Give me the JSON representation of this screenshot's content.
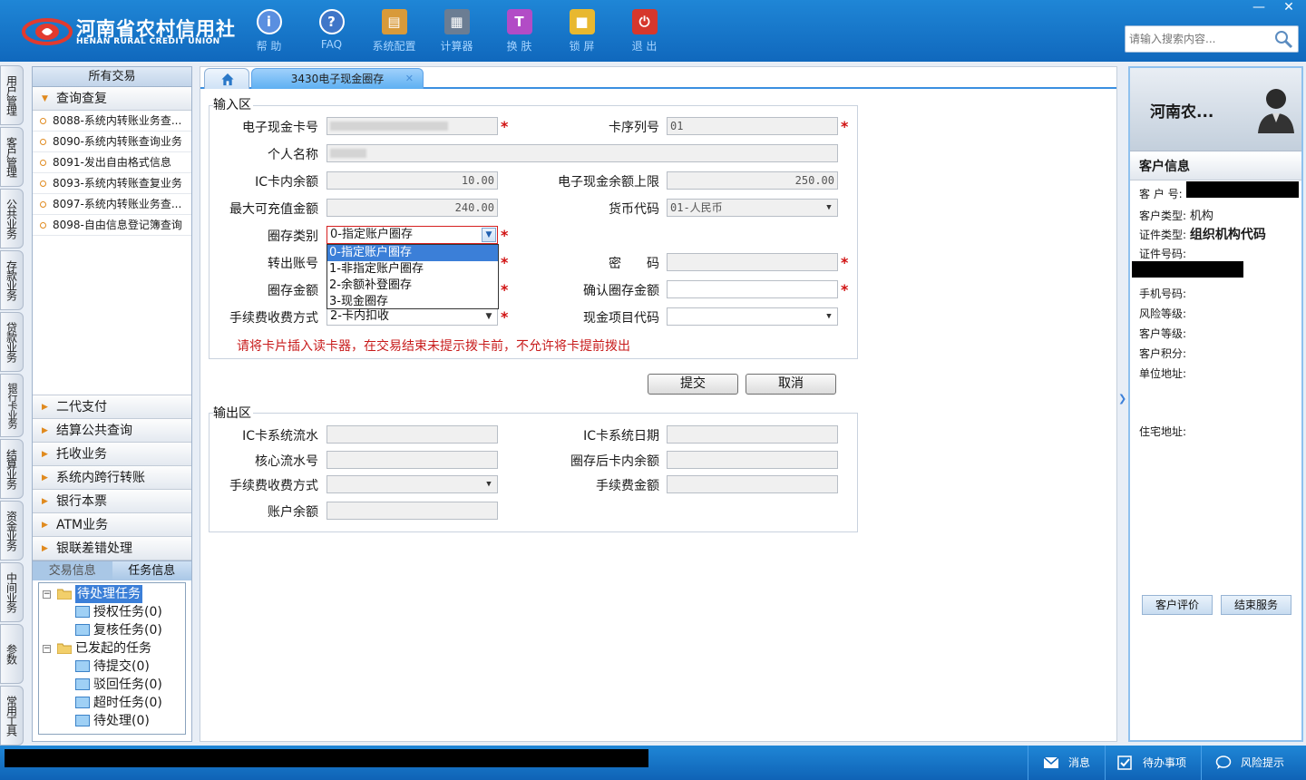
{
  "app": {
    "logo_name": "河南省农村信用社",
    "logo_sub": "HENAN RURAL CREDIT UNION",
    "search_placeholder": "请输入搜索内容..."
  },
  "toolbar": [
    {
      "label": "帮 助",
      "icon": "info-icon",
      "color": "#5a8fe0"
    },
    {
      "label": "FAQ",
      "icon": "question-icon",
      "color": "#3f76c8"
    },
    {
      "label": "系统配置",
      "icon": "toolbox-icon",
      "color": "#d89a3a"
    },
    {
      "label": "计算器",
      "icon": "calculator-icon",
      "color": "#6b7d93"
    },
    {
      "label": "换 肤",
      "icon": "shirt-icon",
      "color": "#b24cc6"
    },
    {
      "label": "锁 屏",
      "icon": "lock-icon",
      "color": "#e8b830"
    },
    {
      "label": "退 出",
      "icon": "power-icon",
      "color": "#d6372c"
    }
  ],
  "vtabs": [
    "用户管理",
    "客户管理",
    "公共业务",
    "存款业务",
    "贷款业务",
    "银行卡业务",
    "结算业务",
    "资金业务",
    "中间业务",
    "参数",
    "常用工具"
  ],
  "leftnav": {
    "top": "所有交易",
    "open_group": "查询查复",
    "items": [
      "8088-系统内转账业务查...",
      "8090-系统内转账查询业务",
      "8091-发出自由格式信息",
      "8093-系统内转账查复业务",
      "8097-系统内转账业务查...",
      "8098-自由信息登记簿查询"
    ],
    "groups": [
      "二代支付",
      "结算公共查询",
      "托收业务",
      "系统内跨行转账",
      "银行本票",
      "ATM业务",
      "银联差错处理"
    ],
    "task_tabs": [
      "交易信息",
      "任务信息"
    ],
    "tree": {
      "pending": "待处理任务",
      "pending_children": [
        "授权任务(0)",
        "复核任务(0)"
      ],
      "initiated": "已发起的任务",
      "initiated_children": [
        "待提交(0)",
        "驳回任务(0)",
        "超时任务(0)",
        "待处理(0)"
      ]
    }
  },
  "tabs": {
    "page_tab": "3430电子现金圈存"
  },
  "input_section": {
    "legend": "输入区",
    "labels": {
      "card_no": "电子现金卡号",
      "card_seq": "卡序列号",
      "name": "个人名称",
      "ic_balance": "IC卡内余额",
      "ecash_limit": "电子现金余额上限",
      "max_recharge": "最大可充值金额",
      "currency": "货币代码",
      "load_type": "圈存类别",
      "out_account": "转出账号",
      "password": "密　　码",
      "load_amount": "圈存金额",
      "confirm_amount": "确认圈存金额",
      "fee_method": "手续费收费方式",
      "cash_item_code": "现金项目代码"
    },
    "values": {
      "card_seq": "01",
      "ic_balance": "10.00",
      "ecash_limit": "250.00",
      "max_recharge": "240.00",
      "currency": "01-人民币",
      "load_type": "0-指定账户圈存",
      "fee_method": "2-卡内扣收"
    },
    "load_type_options": [
      "0-指定账户圈存",
      "1-非指定账户圈存",
      "2-余额补登圈存",
      "3-现金圈存"
    ],
    "notice": "请将卡片插入读卡器，在交易结束未提示拨卡前，不允许将卡提前拨出",
    "submit": "提交",
    "cancel": "取消"
  },
  "output_section": {
    "legend": "输出区",
    "labels": {
      "ic_serial": "IC卡系统流水",
      "ic_date": "IC卡系统日期",
      "core_serial": "核心流水号",
      "post_balance": "圈存后卡内余额",
      "fee_method": "手续费收费方式",
      "fee_amount": "手续费金额",
      "account_balance": "账户余额"
    }
  },
  "customer": {
    "header_title": "河南农...",
    "section_title": "客户信息",
    "customer_no_label": "客 户 号:",
    "customer_type_label": "客户类型:",
    "customer_type": "机构",
    "id_type_label": "证件类型:",
    "id_type": "组织机构代码",
    "id_no_label": "证件号码:",
    "mobile_label": "手机号码:",
    "risk_label": "风险等级:",
    "level_label": "客户等级:",
    "points_label": "客户积分:",
    "work_addr_label": "单位地址:",
    "home_addr_label": "住宅地址:",
    "evaluate": "客户评价",
    "end_service": "结束服务"
  },
  "statusbar": {
    "messages": "消息",
    "todo": "待办事项",
    "risk": "风险提示"
  }
}
